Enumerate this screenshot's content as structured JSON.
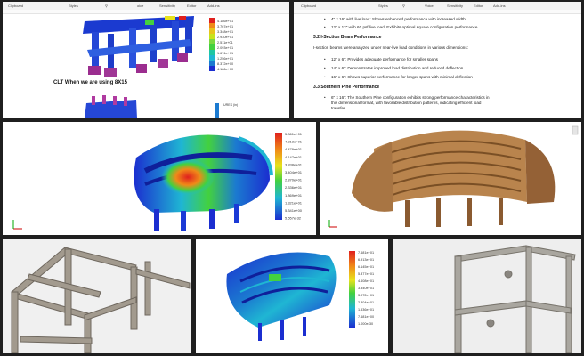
{
  "ribbon": {
    "clipboard": "Clipboard",
    "styles": "Styles",
    "voice": "Voice",
    "sensitivity": "Sensitivity",
    "editor": "Editor",
    "add_ins": "Add-ins",
    "voice_left": "oice"
  },
  "doc_left": {
    "heading": "CLT When we are using 8X15",
    "legend_top": [
      {
        "label": "4.186e+01",
        "color": "#e0201e"
      },
      {
        "label": "3.767e+01",
        "color": "#f08a18"
      },
      {
        "label": "3.348e+01",
        "color": "#e8c41c"
      },
      {
        "label": "2.930e+01",
        "color": "#c8e31c"
      },
      {
        "label": "2.511e+01",
        "color": "#7bd83f"
      },
      {
        "label": "2.093e+01",
        "color": "#43d13f"
      },
      {
        "label": "1.674e+01",
        "color": "#1fc6a3"
      },
      {
        "label": "1.256e+01",
        "color": "#1fb6d3"
      },
      {
        "label": "8.372e+00",
        "color": "#1b7ad0"
      },
      {
        "label": "4.186e+00",
        "color": "#1b2ed0"
      }
    ],
    "legend_lower_title": "URES (in)"
  },
  "doc_right": {
    "bullet_top_1": "4\" x 16\" with live load: Shows enhanced performance with increased width",
    "bullet_top_2": "12\" x 12\" with 60 psf live load: Exhibits optimal square configuration performance",
    "section_1": "3.2 I-Section Beam Performance",
    "para_1": "I-section beams were analyzed under near-live load conditions in various dimensions:",
    "bullet_1": "12\" x 6\": Provides adequate performance for smaller spans",
    "bullet_2": "14\" x 6\": Demonstrates improved load distribution and reduced deflection",
    "bullet_3": "16\" x 6\": Shows superior performance for longer spans with minimal deflection",
    "section_2": "3.3 Southern Pine Performance",
    "bullet_4": "6\" x 16\": The Southern Pine configuration exhibits strong performance characteristics in",
    "para_2a": "this dimensional format, with favorable distribution patterns, indicating efficient load",
    "para_2b": "transfer."
  },
  "fea_large": {
    "legend": [
      "5.861e+01",
      "4.813e+01",
      "4.479e+01",
      "4.147e+01",
      "3.838e+01",
      "3.404e+01",
      "2.870e+01",
      "2.336e+01",
      "1.869e+01",
      "1.321e+01",
      "5.341e+00",
      "5.557e-32"
    ]
  },
  "fea_small": {
    "legend": [
      "7.681e+01",
      "6.913e+01",
      "6.145e+01",
      "5.377e+01",
      "4.608e+01",
      "3.840e+01",
      "3.072e+01",
      "2.304e+01",
      "1.536e+01",
      "7.681e+00",
      "1.000e-30"
    ]
  },
  "colors": {
    "max": "#e0201e",
    "high": "#f08a18",
    "mid": "#e8e31c",
    "midlow": "#43d13f",
    "low": "#1fb6d3",
    "min": "#1b2ed0",
    "wood": "#a87543",
    "steel": "#9a9a9a"
  }
}
